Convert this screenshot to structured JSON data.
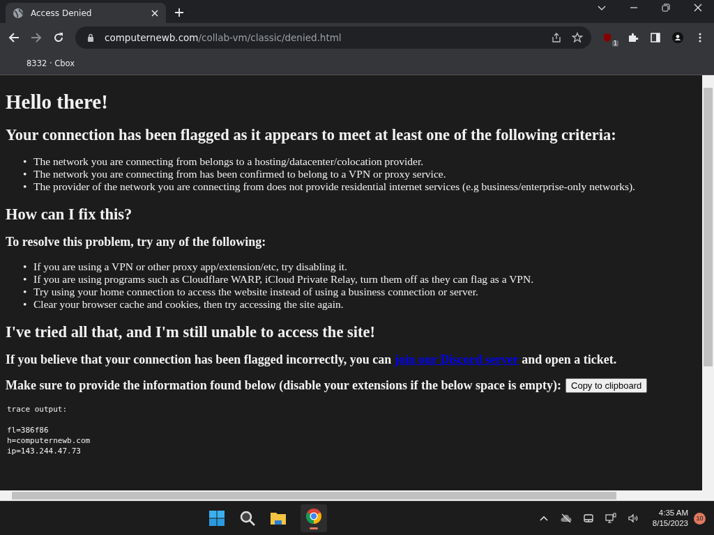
{
  "tabs": [
    {
      "title": "Access Denied",
      "selected": true
    }
  ],
  "address_bar": {
    "domain": "computernewb.com",
    "path": "/collab-vm/classic/denied.html"
  },
  "extension_badge": "1",
  "bookmarks": [
    "8332 · Cbox"
  ],
  "page": {
    "heading": "Hello there!",
    "criteria_heading": "Your connection has been flagged as it appears to meet at least one of the following criteria:",
    "criteria": [
      "The network you are connecting from belongs to a hosting/datacenter/colocation provider.",
      "The network you are connecting from has been confirmed to belong to a VPN or proxy service.",
      "The provider of the network you are connecting from does not provide residential internet services (e.g business/enterprise-only networks)."
    ],
    "fix_heading": "How can I fix this?",
    "fix_subheading": "To resolve this problem, try any of the following:",
    "fixes": [
      "If you are using a VPN or other proxy app/extension/etc, try disabling it.",
      "If you are using programs such as Cloudflare WARP, iCloud Private Relay, turn them off as they can flag as a VPN.",
      "Try using your home connection to access the website instead of using a business connection or server.",
      "Clear your browser cache and cookies, then try accessing the site again."
    ],
    "still_heading": "I've tried all that, and I'm still unable to access the site!",
    "ticket_before": "If you believe that your connection has been flagged incorrectly, you can",
    "ticket_link": "join our Discord server",
    "ticket_after": "and open a ticket.",
    "info_text": "Make sure to provide the information found below (disable your extensions if the below space is empty):",
    "copy_button": "Copy to clipboard",
    "bullet": "•",
    "trace_title": "trace output:",
    "trace": [
      "fl=386f86",
      "h=computernewb.com",
      "ip=143.244.47.73"
    ]
  },
  "taskbar": {
    "time": "4:35 AM",
    "date": "8/15/2023",
    "notifications": "10"
  }
}
